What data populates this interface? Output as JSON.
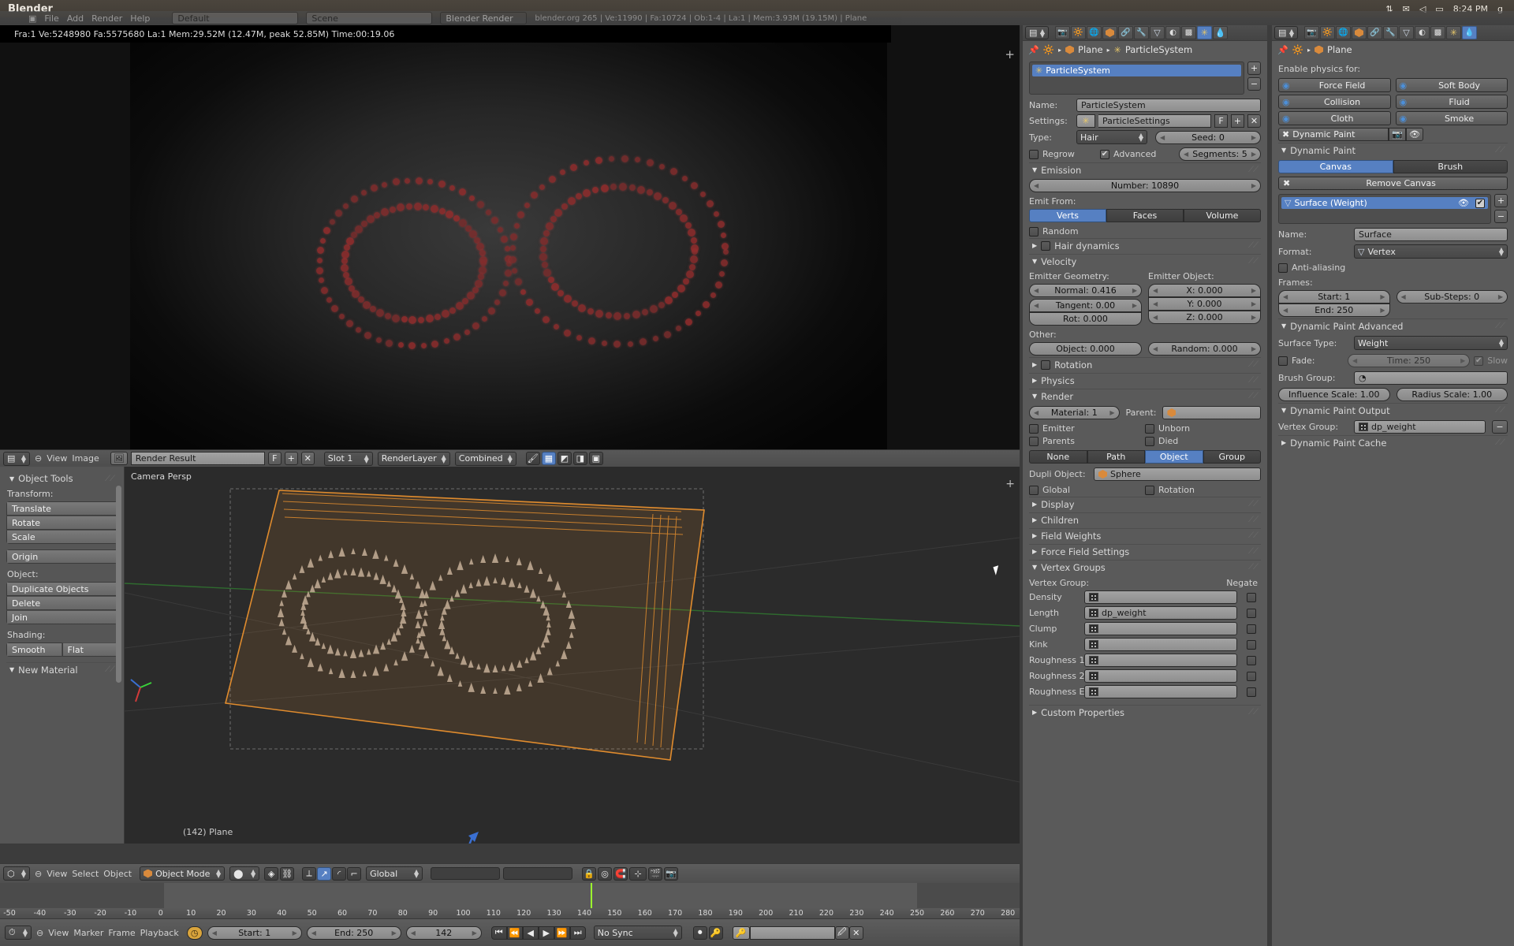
{
  "app": {
    "title": "Blender"
  },
  "menubar": {
    "items": [
      "File",
      "Add",
      "Render",
      "Help"
    ],
    "screen_layout": "Default",
    "scene": "Scene",
    "engine": "Blender Render",
    "version_info": "blender.org 265 | Ve:11990 | Fa:10724 | Ob:1-4 | La:1 | Mem:3.93M (19.15M) | Plane"
  },
  "clock": {
    "time": "8:24 PM",
    "icons": [
      "network-icon",
      "mail-icon",
      "volume-icon",
      "battery-icon"
    ],
    "user": "g"
  },
  "render": {
    "stats": "Fra:1  Ve:5248980 Fa:5575680 La:1 Mem:29.52M (12.47M, peak 52.85M) Time:00:19.06"
  },
  "image_editor": {
    "menus": [
      "View",
      "Image"
    ],
    "datablock": "Render Result",
    "fake_user": "F",
    "slot": "Slot 1",
    "layer": "RenderLayer",
    "pass": "Combined"
  },
  "toolshelf": {
    "panel_title": "Object Tools",
    "transform_label": "Transform:",
    "transform_buttons": [
      "Translate",
      "Rotate",
      "Scale"
    ],
    "origin_button": "Origin",
    "object_label": "Object:",
    "object_buttons": [
      "Duplicate Objects",
      "Delete",
      "Join"
    ],
    "shading_label": "Shading:",
    "shading_buttons": [
      "Smooth",
      "Flat"
    ],
    "new_material_panel": "New Material"
  },
  "viewport": {
    "view_name": "Camera Persp",
    "object_label": "(142) Plane",
    "header": {
      "menus": [
        "View",
        "Select",
        "Object"
      ],
      "mode": "Object Mode",
      "orientation": "Global"
    }
  },
  "timeline": {
    "menus": [
      "View",
      "Marker",
      "Frame",
      "Playback"
    ],
    "start": "Start: 1",
    "end": "End: 250",
    "current_frame": "142",
    "sync": "No Sync",
    "ruler_ticks": [
      "-50",
      "-40",
      "-30",
      "-20",
      "-10",
      "0",
      "10",
      "20",
      "30",
      "40",
      "50",
      "60",
      "70",
      "80",
      "90",
      "100",
      "110",
      "120",
      "130",
      "140",
      "150",
      "160",
      "170",
      "180",
      "190",
      "200",
      "210",
      "220",
      "230",
      "240",
      "250",
      "260",
      "270",
      "280"
    ],
    "playhead_frame": 142,
    "range_start": 1,
    "range_end": 250
  },
  "properties_particles": {
    "breadcrumb": [
      "Plane",
      "ParticleSystem"
    ],
    "list_item": "ParticleSystem",
    "name_label": "Name:",
    "name_value": "ParticleSystem",
    "settings_label": "Settings:",
    "settings_value": "ParticleSettings",
    "settings_fake_user": "F",
    "type_label": "Type:",
    "type_value": "Hair",
    "seed": "Seed: 0",
    "regrow": "Regrow",
    "advanced": "Advanced",
    "segments": "Segments: 5",
    "emission": {
      "title": "Emission",
      "number": "Number: 10890",
      "emit_from_label": "Emit From:",
      "emit_from_options": [
        "Verts",
        "Faces",
        "Volume"
      ],
      "emit_from_active": "Verts",
      "random": "Random"
    },
    "hair_dynamics": "Hair dynamics",
    "velocity": {
      "title": "Velocity",
      "emitter_geometry_label": "Emitter Geometry:",
      "normal": "Normal: 0.416",
      "tangent": "Tangent: 0.00",
      "rot": "Rot: 0.000",
      "emitter_object_label": "Emitter Object:",
      "x": "X: 0.000",
      "y": "Y: 0.000",
      "z": "Z: 0.000",
      "other_label": "Other:",
      "object": "Object: 0.000",
      "random": "Random: 0.000"
    },
    "rotation": "Rotation",
    "physics": "Physics",
    "render": {
      "title": "Render",
      "material": "Material: 1",
      "parent_label": "Parent:",
      "parent_value": "",
      "emitter": "Emitter",
      "unborn": "Unborn",
      "parents": "Parents",
      "died": "Died",
      "mode_options": [
        "None",
        "Path",
        "Object",
        "Group"
      ],
      "mode_active": "Object",
      "dupli_object_label": "Dupli Object:",
      "dupli_object_value": "Sphere",
      "global": "Global",
      "rotation": "Rotation"
    },
    "display": "Display",
    "children": "Children",
    "field_weights": "Field Weights",
    "force_field_settings": "Force Field Settings",
    "vertex_groups": {
      "title": "Vertex Groups",
      "col_label": "Vertex Group:",
      "negate_label": "Negate",
      "rows": [
        {
          "label": "Density",
          "value": ""
        },
        {
          "label": "Length",
          "value": "dp_weight"
        },
        {
          "label": "Clump",
          "value": ""
        },
        {
          "label": "Kink",
          "value": ""
        },
        {
          "label": "Roughness 1",
          "value": ""
        },
        {
          "label": "Roughness 2",
          "value": ""
        },
        {
          "label": "Roughness En",
          "value": ""
        }
      ]
    },
    "custom_properties": "Custom Properties"
  },
  "properties_physics": {
    "breadcrumb": [
      "Plane"
    ],
    "enable_label": "Enable physics for:",
    "physics_buttons": [
      {
        "label": "Force Field",
        "icon": "force-field-icon"
      },
      {
        "label": "Soft Body",
        "icon": "soft-body-icon"
      },
      {
        "label": "Collision",
        "icon": "collision-icon"
      },
      {
        "label": "Fluid",
        "icon": "fluid-icon"
      },
      {
        "label": "Cloth",
        "icon": "cloth-icon"
      },
      {
        "label": "Smoke",
        "icon": "smoke-icon"
      }
    ],
    "dynamic_paint_button": "Dynamic Paint",
    "dynamic_paint": {
      "title": "Dynamic Paint",
      "type_options": [
        "Canvas",
        "Brush"
      ],
      "type_active": "Canvas",
      "remove_button": "Remove Canvas",
      "surface_item": "Surface (Weight)",
      "name_label": "Name:",
      "name_value": "Surface",
      "format_label": "Format:",
      "format_value": "Vertex",
      "antialiasing": "Anti-aliasing",
      "frames_label": "Frames:",
      "start": "Start: 1",
      "sub_steps": "Sub-Steps: 0",
      "end": "End: 250"
    },
    "advanced": {
      "title": "Dynamic Paint Advanced",
      "surface_type_label": "Surface Type:",
      "surface_type_value": "Weight",
      "fade": "Fade:",
      "time": "Time: 250",
      "slow": "Slow",
      "brush_group_label": "Brush Group:",
      "brush_group_value": "",
      "influence_scale": "Influence Scale: 1.00",
      "radius_scale": "Radius Scale: 1.00"
    },
    "output": {
      "title": "Dynamic Paint Output",
      "vertex_group_label": "Vertex Group:",
      "vertex_group_value": "dp_weight"
    },
    "cache": "Dynamic Paint Cache"
  },
  "colors": {
    "accent_blue": "#5680c2",
    "panel_bg": "#5a5a5a",
    "header_bg": "#4f4f4f",
    "particle_orange": "#d98a3c",
    "render_red": "#8c3a3a",
    "playhead_green": "#9cff2e"
  }
}
